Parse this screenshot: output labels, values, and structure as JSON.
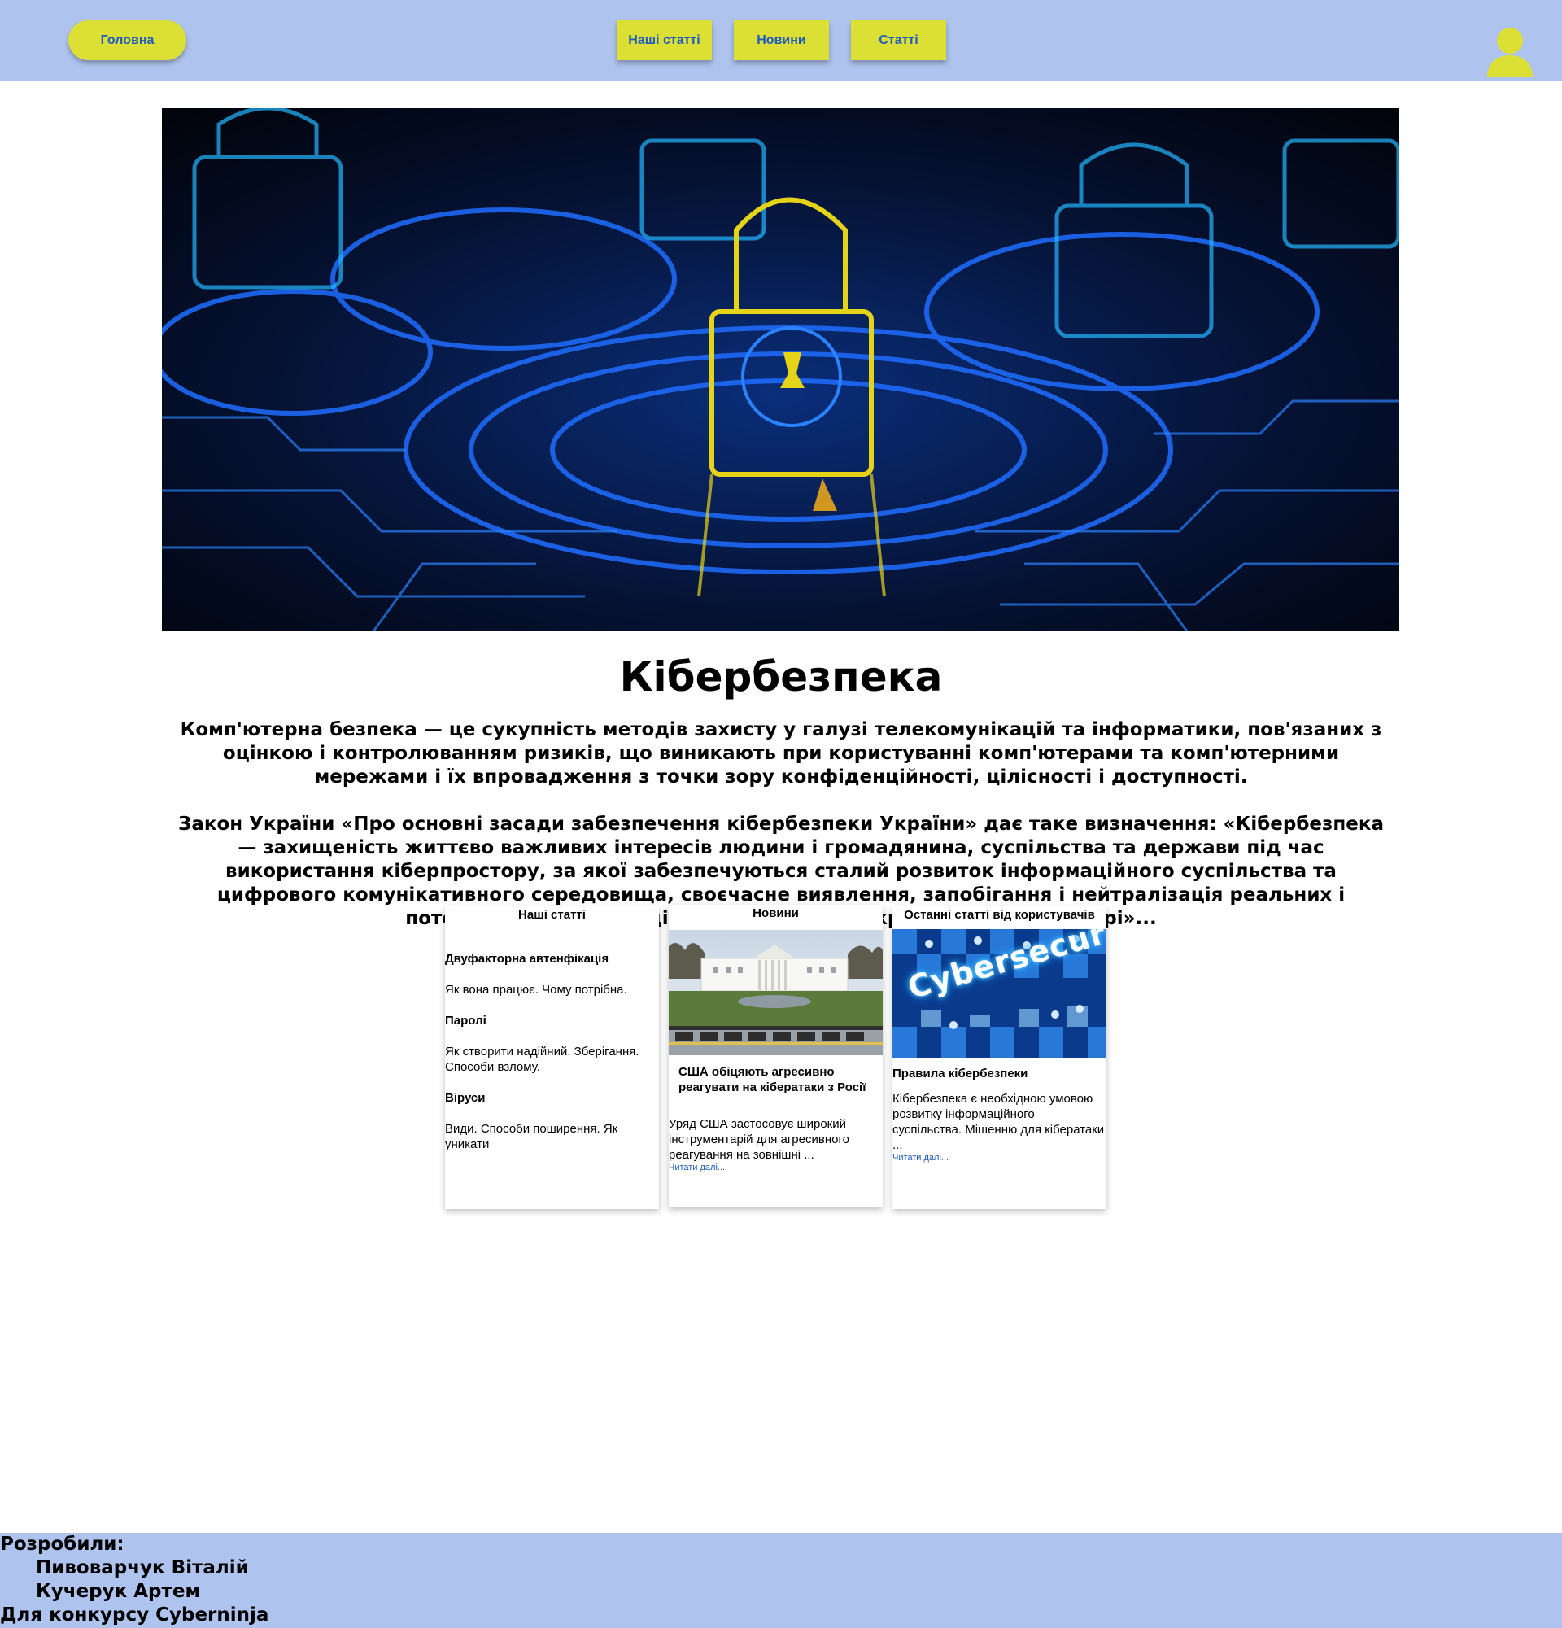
{
  "nav": {
    "home": "Головна",
    "items": [
      "Наші статті",
      "Новини",
      "Статті"
    ]
  },
  "colors": {
    "header_bg": "#aec3ed",
    "button_bg": "#dde034",
    "button_text": "#1d5bbf"
  },
  "icons": {
    "user": "user-icon"
  },
  "main": {
    "title": "Кібербезпека",
    "paragraph1": "Комп'ютерна безпека — це сукупність методів захисту у галузі телекомунікацій та інформатики, пов'язаних з оцінкою і контролюванням ризиків, що виникають при користуванні комп'ютерами та комп'ютерними мережами і їх впровадження з точки зору конфіденційності, цілісності і доступності.",
    "paragraph2": "Закон України «Про основні засади забезпечення кібербезпеки України» дає таке визначення: «Кібербезпека — захищеність життєво важливих інтересів людини і громадянина, суспільства та держави під час використання кіберпростору, за якої забезпечуються сталий розвиток інформаційного суспільства та цифрового комунікативного середовища, своєчасне виявлення, запобігання і нейтралізація реальних і потенційних загроз національній безпеці України у кіберпросторі»..."
  },
  "cards": {
    "our_articles": {
      "heading": "Наші статті",
      "items": [
        {
          "title": "Двуфакторна автенфікація",
          "desc": "Як вона працює. Чому потрібна."
        },
        {
          "title": "Паролі",
          "desc": "Як створити надійний. Зберігання. Способи взлому."
        },
        {
          "title": "Віруси",
          "desc": "Види. Способи поширення. Як уникати"
        }
      ]
    },
    "news": {
      "heading": "Новини",
      "title": "США обіцяють агресивно реагувати на кібератаки з Росії",
      "desc": "Уряд США застосовує широкий інструментарій для агресивного реагування на зовнішні ...",
      "read_more": "Читати далі..."
    },
    "latest": {
      "heading": "Останні статті від користувачів",
      "image_text": "Cybersecurity",
      "title": "Правила кібербезпеки",
      "desc": "Кібербезпека є необхідною умовою розвитку інформаційного суспільства. Мішенню для кібератаки ...",
      "read_more": "Читати далі..."
    }
  },
  "footer": {
    "developed_by": "Розробили:",
    "authors": [
      "Пивоварчук Віталій",
      "Кучерук Артем"
    ],
    "contest": "Для конкурсу Cyberninja"
  }
}
